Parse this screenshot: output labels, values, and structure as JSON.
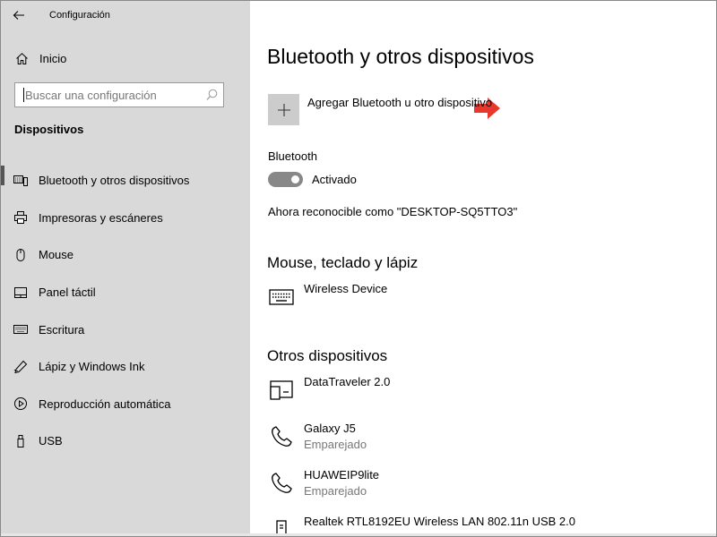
{
  "window": {
    "title": "Configuración"
  },
  "sidebar": {
    "home_label": "Inicio",
    "search_placeholder": "Buscar una configuración",
    "section_title": "Dispositivos",
    "items": [
      {
        "label": "Bluetooth y otros dispositivos",
        "icon": "bluetooth-devices-icon",
        "active": true
      },
      {
        "label": "Impresoras y escáneres",
        "icon": "printer-icon"
      },
      {
        "label": "Mouse",
        "icon": "mouse-icon"
      },
      {
        "label": "Panel táctil",
        "icon": "touchpad-icon"
      },
      {
        "label": "Escritura",
        "icon": "keyboard-icon"
      },
      {
        "label": "Lápiz y Windows Ink",
        "icon": "pen-icon"
      },
      {
        "label": "Reproducción automática",
        "icon": "autoplay-icon"
      },
      {
        "label": "USB",
        "icon": "usb-icon"
      }
    ]
  },
  "main": {
    "title": "Bluetooth y otros dispositivos",
    "add_device_label": "Agregar Bluetooth u otro dispositivo",
    "bluetooth_heading": "Bluetooth",
    "bluetooth_toggle_label": "Activado",
    "bluetooth_on": true,
    "discoverable_text": "Ahora reconocible como \"DESKTOP-SQ5TTO3\"",
    "mouse_section": {
      "heading": "Mouse, teclado y lápiz",
      "devices": [
        {
          "name": "Wireless Device",
          "icon": "keyboard-icon"
        }
      ]
    },
    "other_section": {
      "heading": "Otros dispositivos",
      "devices": [
        {
          "name": "DataTraveler 2.0",
          "status": "",
          "icon": "drive-icon"
        },
        {
          "name": "Galaxy J5",
          "status": "Emparejado",
          "icon": "phone-icon"
        },
        {
          "name": "HUAWEIP9lite",
          "status": "Emparejado",
          "icon": "phone-icon"
        },
        {
          "name": "Realtek RTL8192EU Wireless LAN 802.11n USB 2.0",
          "status": "",
          "icon": "usb-adapter-icon"
        }
      ]
    }
  },
  "colors": {
    "sidebar_bg": "#d9d9d9",
    "toggle_on": "#888888",
    "arrow": "#e8372c"
  }
}
